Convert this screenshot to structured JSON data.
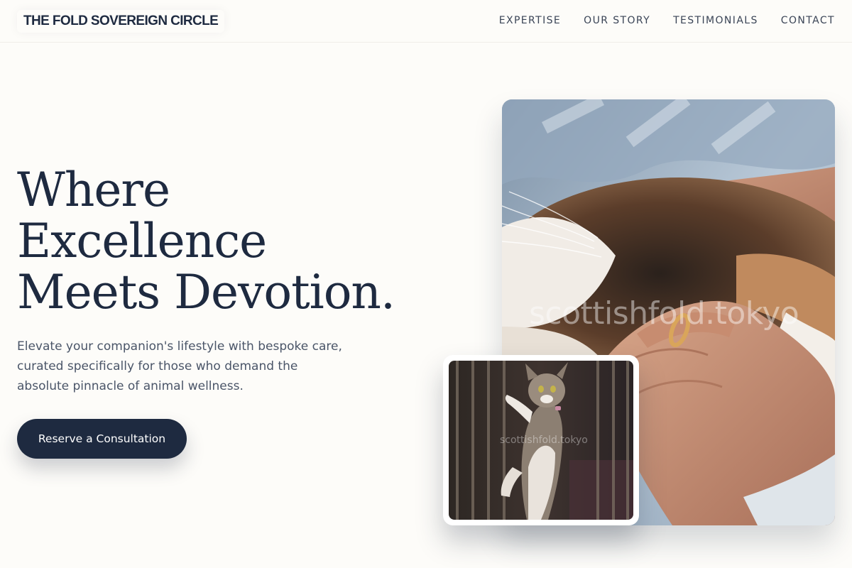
{
  "header": {
    "brand": "THE FOLD SOVEREIGN CIRCLE",
    "nav": [
      {
        "label": "EXPERTISE"
      },
      {
        "label": "OUR STORY"
      },
      {
        "label": "TESTIMONIALS"
      },
      {
        "label": "CONTACT"
      }
    ]
  },
  "hero": {
    "title_lines": [
      "Where",
      "Excellence",
      "Meets Devotion."
    ],
    "subtitle": "Elevate your companion's lifestyle with bespoke care, curated specifically for those who demand the absolute pinnacle of animal wellness.",
    "cta_label": "Reserve a Consultation"
  },
  "images": {
    "main_watermark": "scottishfold.tokyo",
    "small_watermark": "scottishfold.tokyo"
  },
  "colors": {
    "background": "#fdfcf9",
    "navy": "#1e2a40",
    "body_text": "#4a5568"
  }
}
